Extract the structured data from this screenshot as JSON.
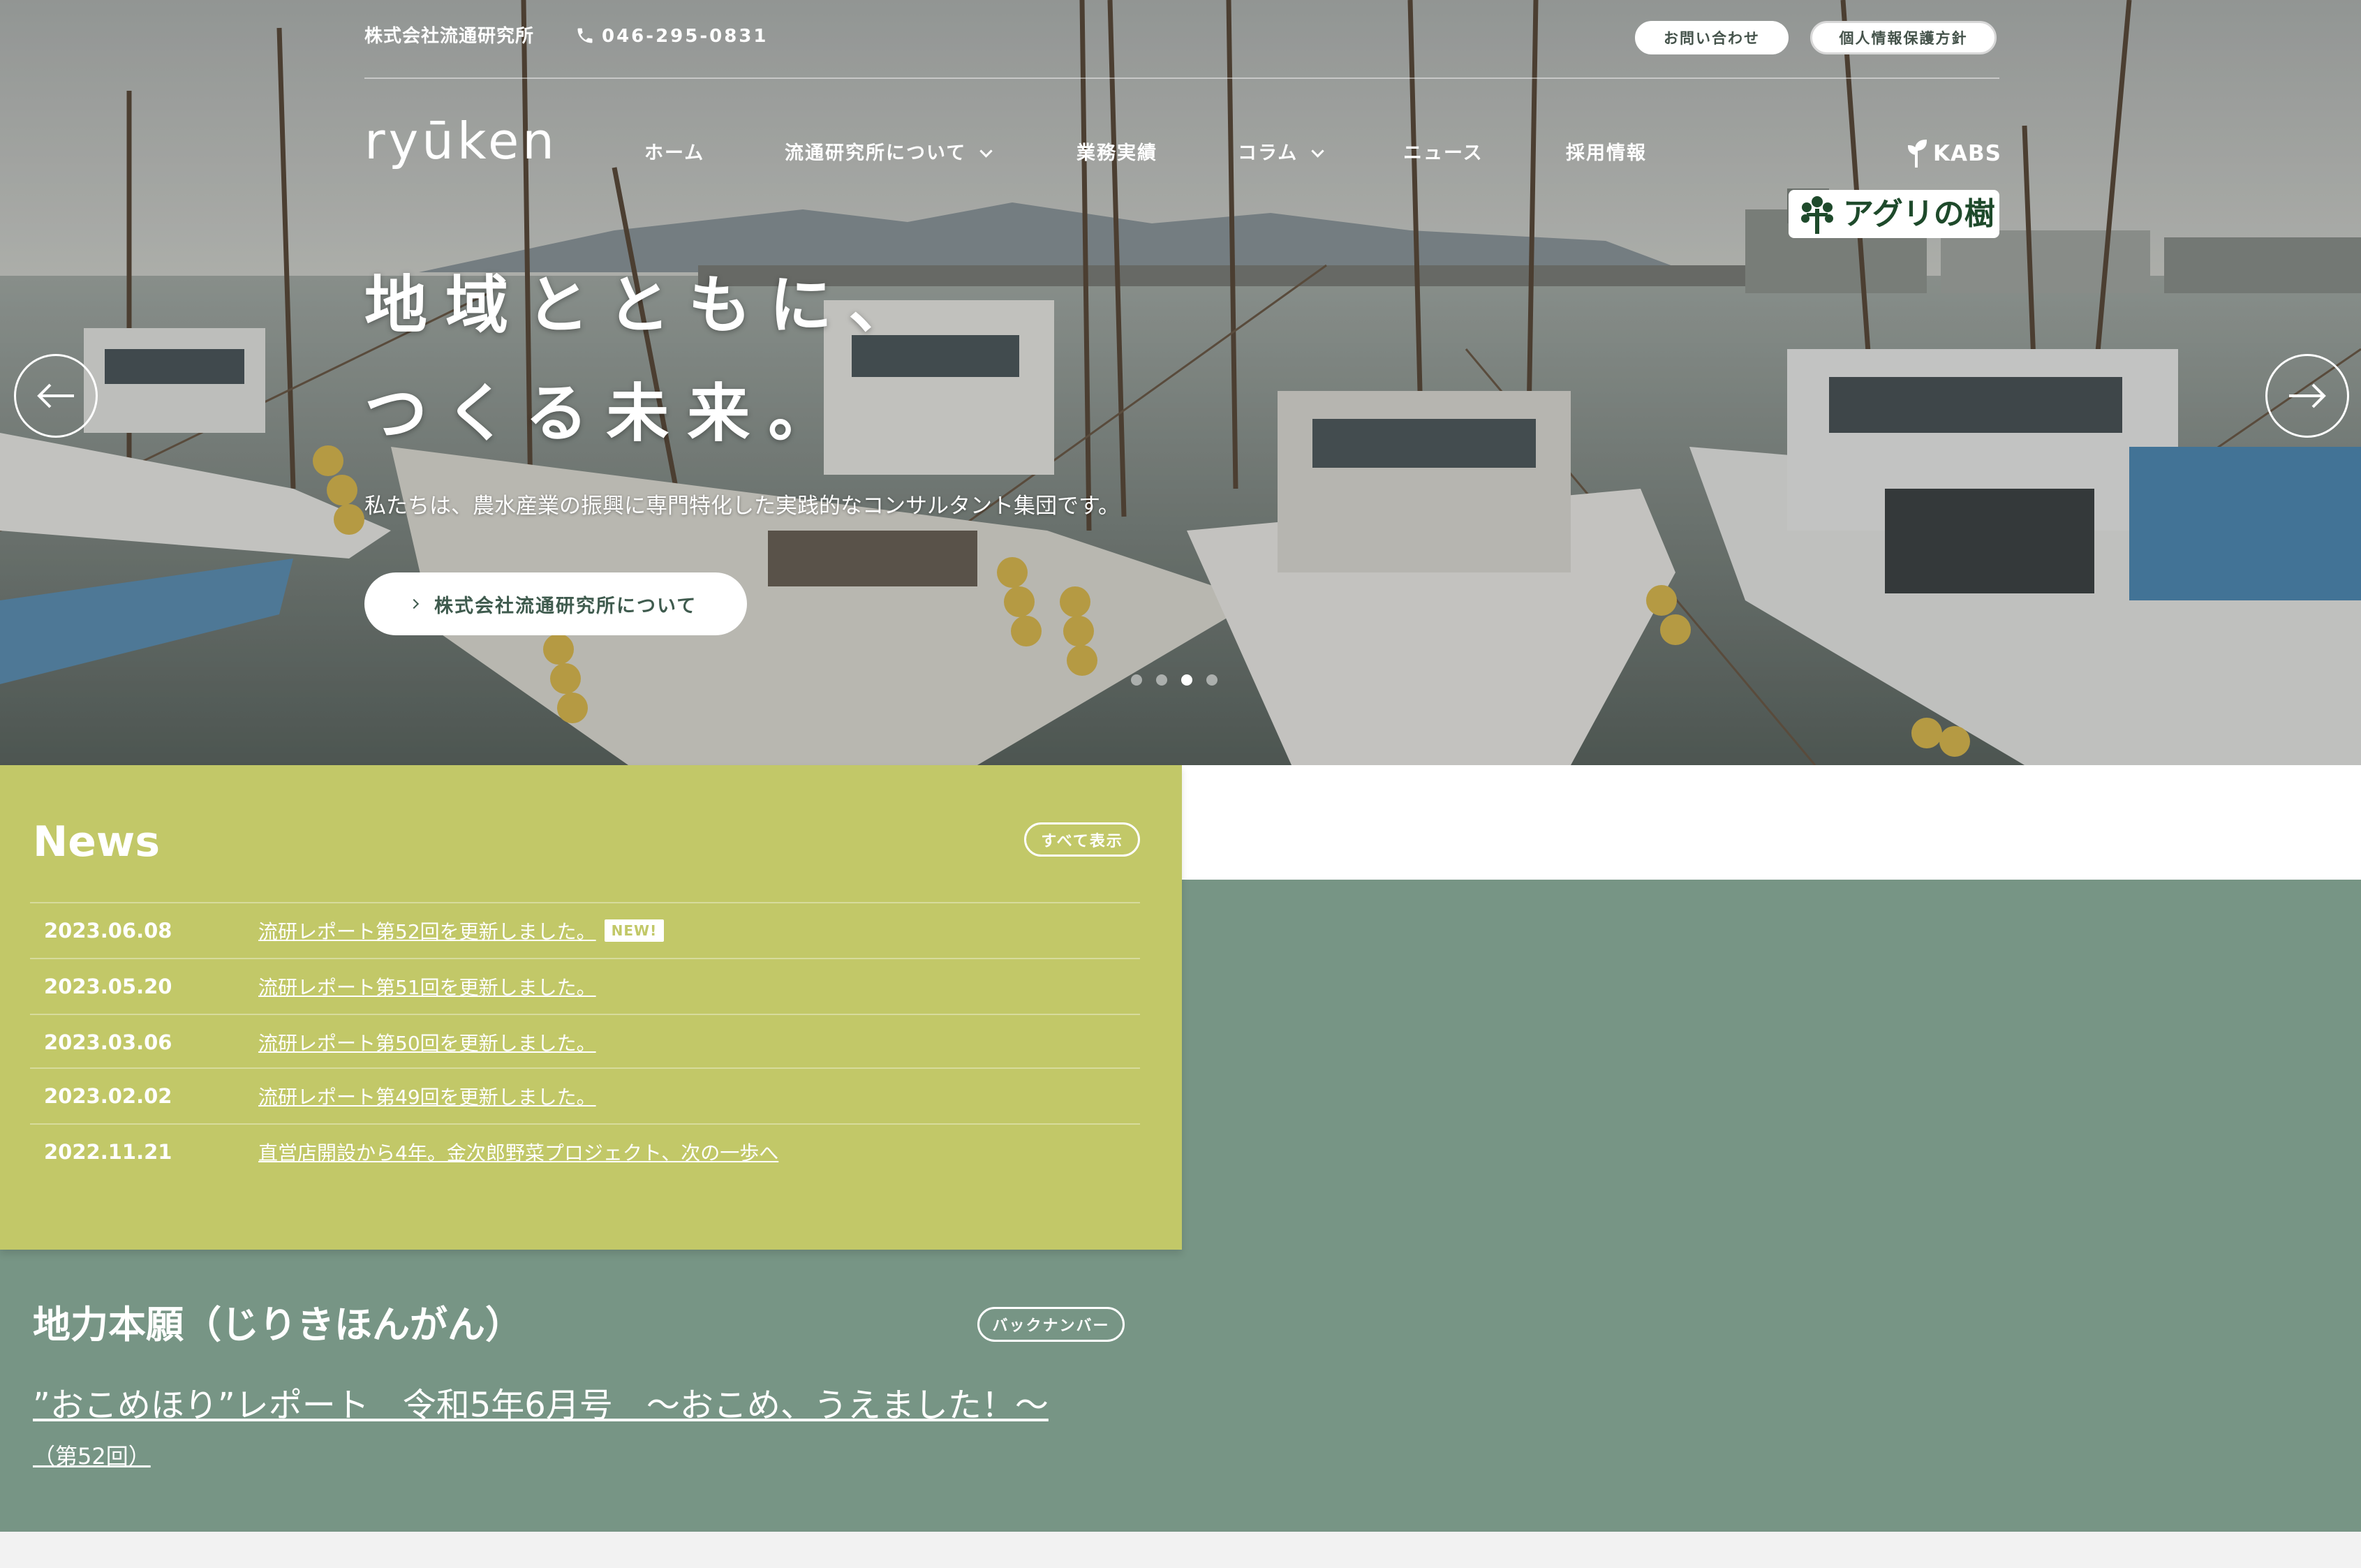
{
  "topbar": {
    "company": "株式会社流通研究所",
    "phone_icon": "phone-icon",
    "phone": "046-295-0831",
    "contact_button": "お問い合わせ",
    "privacy_button": "個人情報保護方針"
  },
  "header": {
    "logo": "ryūken",
    "nav": [
      {
        "label": "ホーム",
        "has_dropdown": false
      },
      {
        "label": "流通研究所について",
        "has_dropdown": true
      },
      {
        "label": "業務実績",
        "has_dropdown": false
      },
      {
        "label": "コラム",
        "has_dropdown": true
      },
      {
        "label": "ニュース",
        "has_dropdown": false
      },
      {
        "label": "採用情報",
        "has_dropdown": false
      }
    ],
    "kabs_icon": "kabs-leaf-icon",
    "kabs_label": "KABS",
    "agri_logo_icon": "tree-icon",
    "agri_logo_text": "アグリの樹"
  },
  "hero": {
    "headline_line1": "地域とともに、",
    "headline_line2": "つくる未来。",
    "subtitle": "私たちは、農水産業の振興に専門特化した実践的なコンサルタント集団です。",
    "cta_label": "株式会社流通研究所について",
    "prev_icon": "arrow-left-icon",
    "next_icon": "arrow-right-icon",
    "slide_count": 4,
    "active_slide": 3
  },
  "news": {
    "title": "News",
    "view_all": "すべて表示",
    "items": [
      {
        "date": "2023.06.08",
        "title": "流研レポート第52回を更新しました。",
        "badge": "NEW!"
      },
      {
        "date": "2023.05.20",
        "title": "流研レポート第51回を更新しました。"
      },
      {
        "date": "2023.03.06",
        "title": "流研レポート第50回を更新しました。"
      },
      {
        "date": "2023.02.02",
        "title": "流研レポート第49回を更新しました。"
      },
      {
        "date": "2022.11.21",
        "title": "直営店開設から4年。金次郎野菜プロジェクト、次の一歩へ"
      }
    ]
  },
  "column": {
    "title": "地力本願（じりきほんがん）",
    "back_number": "バックナンバー",
    "article_title": "”おこめほり”レポート　令和5年6月号　～おこめ、うえました！～",
    "article_issue": "（第52回）"
  },
  "colors": {
    "news_bg": "#c2c868",
    "green_bg": "#779585",
    "cta_text": "#3f5b4e",
    "footer_strip": "#f2f2f2"
  }
}
